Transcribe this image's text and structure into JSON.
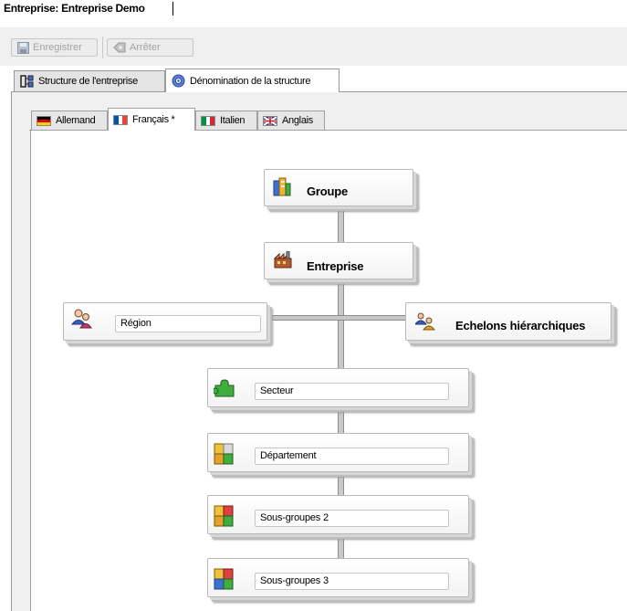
{
  "header": {
    "title": "Entreprise: Entreprise Demo"
  },
  "toolbar": {
    "save_label": "Enregistrer",
    "cancel_label": "Arrêter"
  },
  "main_tabs": [
    {
      "label": "Structure de l'entreprise"
    },
    {
      "label": "Dénomination de la structure"
    }
  ],
  "language_tabs": [
    {
      "label": "Allemand"
    },
    {
      "label": "Français *"
    },
    {
      "label": "Italien"
    },
    {
      "label": "Anglais"
    }
  ],
  "nodes": {
    "groupe": {
      "label": "Groupe"
    },
    "entreprise": {
      "label": "Entreprise"
    },
    "region": {
      "value": "Région"
    },
    "echelons": {
      "label": "Echelons hiérarchiques"
    },
    "secteur": {
      "value": "Secteur"
    },
    "departement": {
      "value": "Département"
    },
    "sous_groupes_2": {
      "value": "Sous-groupes 2"
    },
    "sous_groupes_3": {
      "value": "Sous-groupes 3"
    }
  },
  "colors": {
    "tab_border": "#9a9a9a",
    "panel_bg": "#f0f0f0",
    "node_shadow": "#bdbdbd"
  }
}
